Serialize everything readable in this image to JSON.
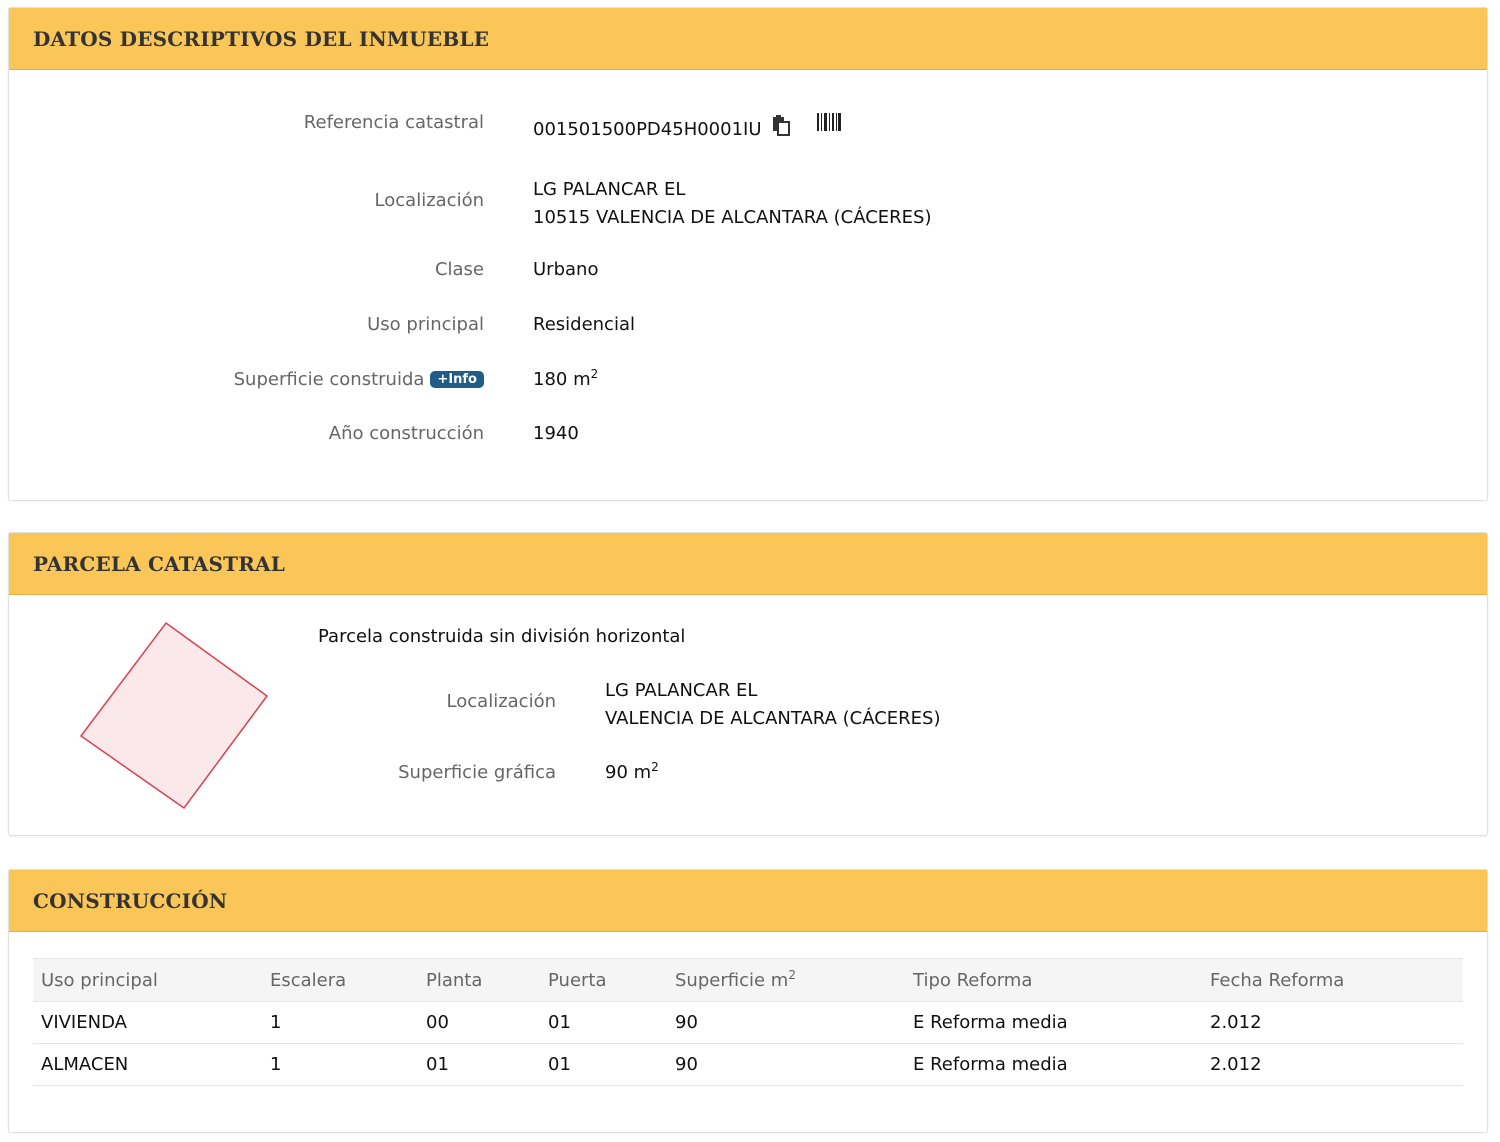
{
  "datos": {
    "title": "DATOS DESCRIPTIVOS DEL INMUEBLE",
    "ref_label": "Referencia catastral",
    "ref_value": "001501500PD45H0001IU",
    "copy_icon": "copy-icon",
    "barcode_icon": "barcode-icon",
    "loc_label": "Localización",
    "loc_line1": "LG PALANCAR EL",
    "loc_line2": "10515 VALENCIA DE ALCANTARA (CÁCERES)",
    "clase_label": "Clase",
    "clase_value": "Urbano",
    "uso_label": "Uso principal",
    "uso_value": "Residencial",
    "sup_label": "Superficie construida",
    "info_badge": "+Info",
    "sup_value": "180 m",
    "sup_unit_exp": "2",
    "anio_label": "Año construcción",
    "anio_value": "1940"
  },
  "parcela": {
    "title": "PARCELA CATASTRAL",
    "desc": "Parcela construida sin división horizontal",
    "loc_label": "Localización",
    "loc_line1": "LG PALANCAR EL",
    "loc_line2": "VALENCIA DE ALCANTARA (CÁCERES)",
    "sup_label": "Superficie gráfica",
    "sup_value": "90 m",
    "sup_unit_exp": "2",
    "shape_fill": "#fbe8ea",
    "shape_stroke": "#d8414f"
  },
  "construccion": {
    "title": "CONSTRUCCIÓN",
    "headers": [
      "Uso principal",
      "Escalera",
      "Planta",
      "Puerta",
      "Superficie m",
      "Tipo Reforma",
      "Fecha Reforma"
    ],
    "sup_header_exp": "2",
    "rows": [
      [
        "VIVIENDA",
        "1",
        "00",
        "01",
        "90",
        "E Reforma media",
        "2.012"
      ],
      [
        "ALMACEN",
        "1",
        "01",
        "01",
        "90",
        "E Reforma media",
        "2.012"
      ]
    ]
  },
  "colors": {
    "header_bg": "#fbc658",
    "badge_bg": "#1f5d87"
  }
}
